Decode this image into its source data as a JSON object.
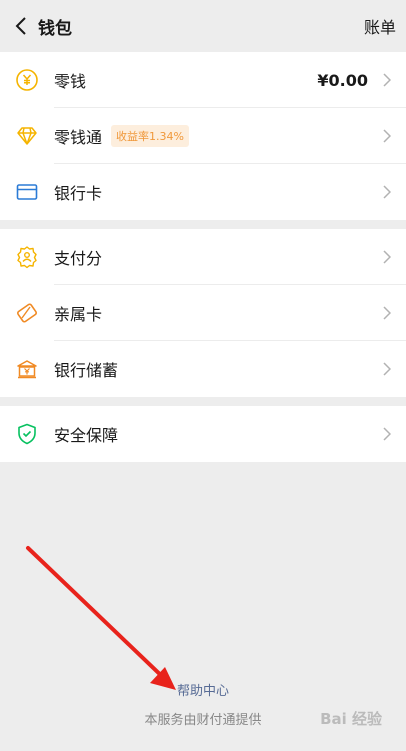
{
  "header": {
    "title": "钱包",
    "right_action": "账单"
  },
  "groups": [
    {
      "items": [
        {
          "label": "零钱",
          "value": "¥0.00",
          "icon": "coin-icon"
        },
        {
          "label": "零钱通",
          "badge": "收益率1.34%",
          "icon": "diamond-icon"
        },
        {
          "label": "银行卡",
          "icon": "bank-card-icon"
        }
      ]
    },
    {
      "items": [
        {
          "label": "支付分",
          "icon": "pay-score-icon"
        },
        {
          "label": "亲属卡",
          "icon": "family-card-icon"
        },
        {
          "label": "银行储蓄",
          "icon": "bank-savings-icon"
        }
      ]
    },
    {
      "items": [
        {
          "label": "安全保障",
          "icon": "shield-icon"
        }
      ]
    }
  ],
  "footer": {
    "help": "帮助中心",
    "provider": "本服务由财付通提供"
  },
  "watermark": "Bai 经验",
  "colors": {
    "yellow": "#f5b400",
    "blue": "#2b7bd6",
    "orange": "#f08a24",
    "green": "#07c160",
    "link": "#576b95"
  }
}
